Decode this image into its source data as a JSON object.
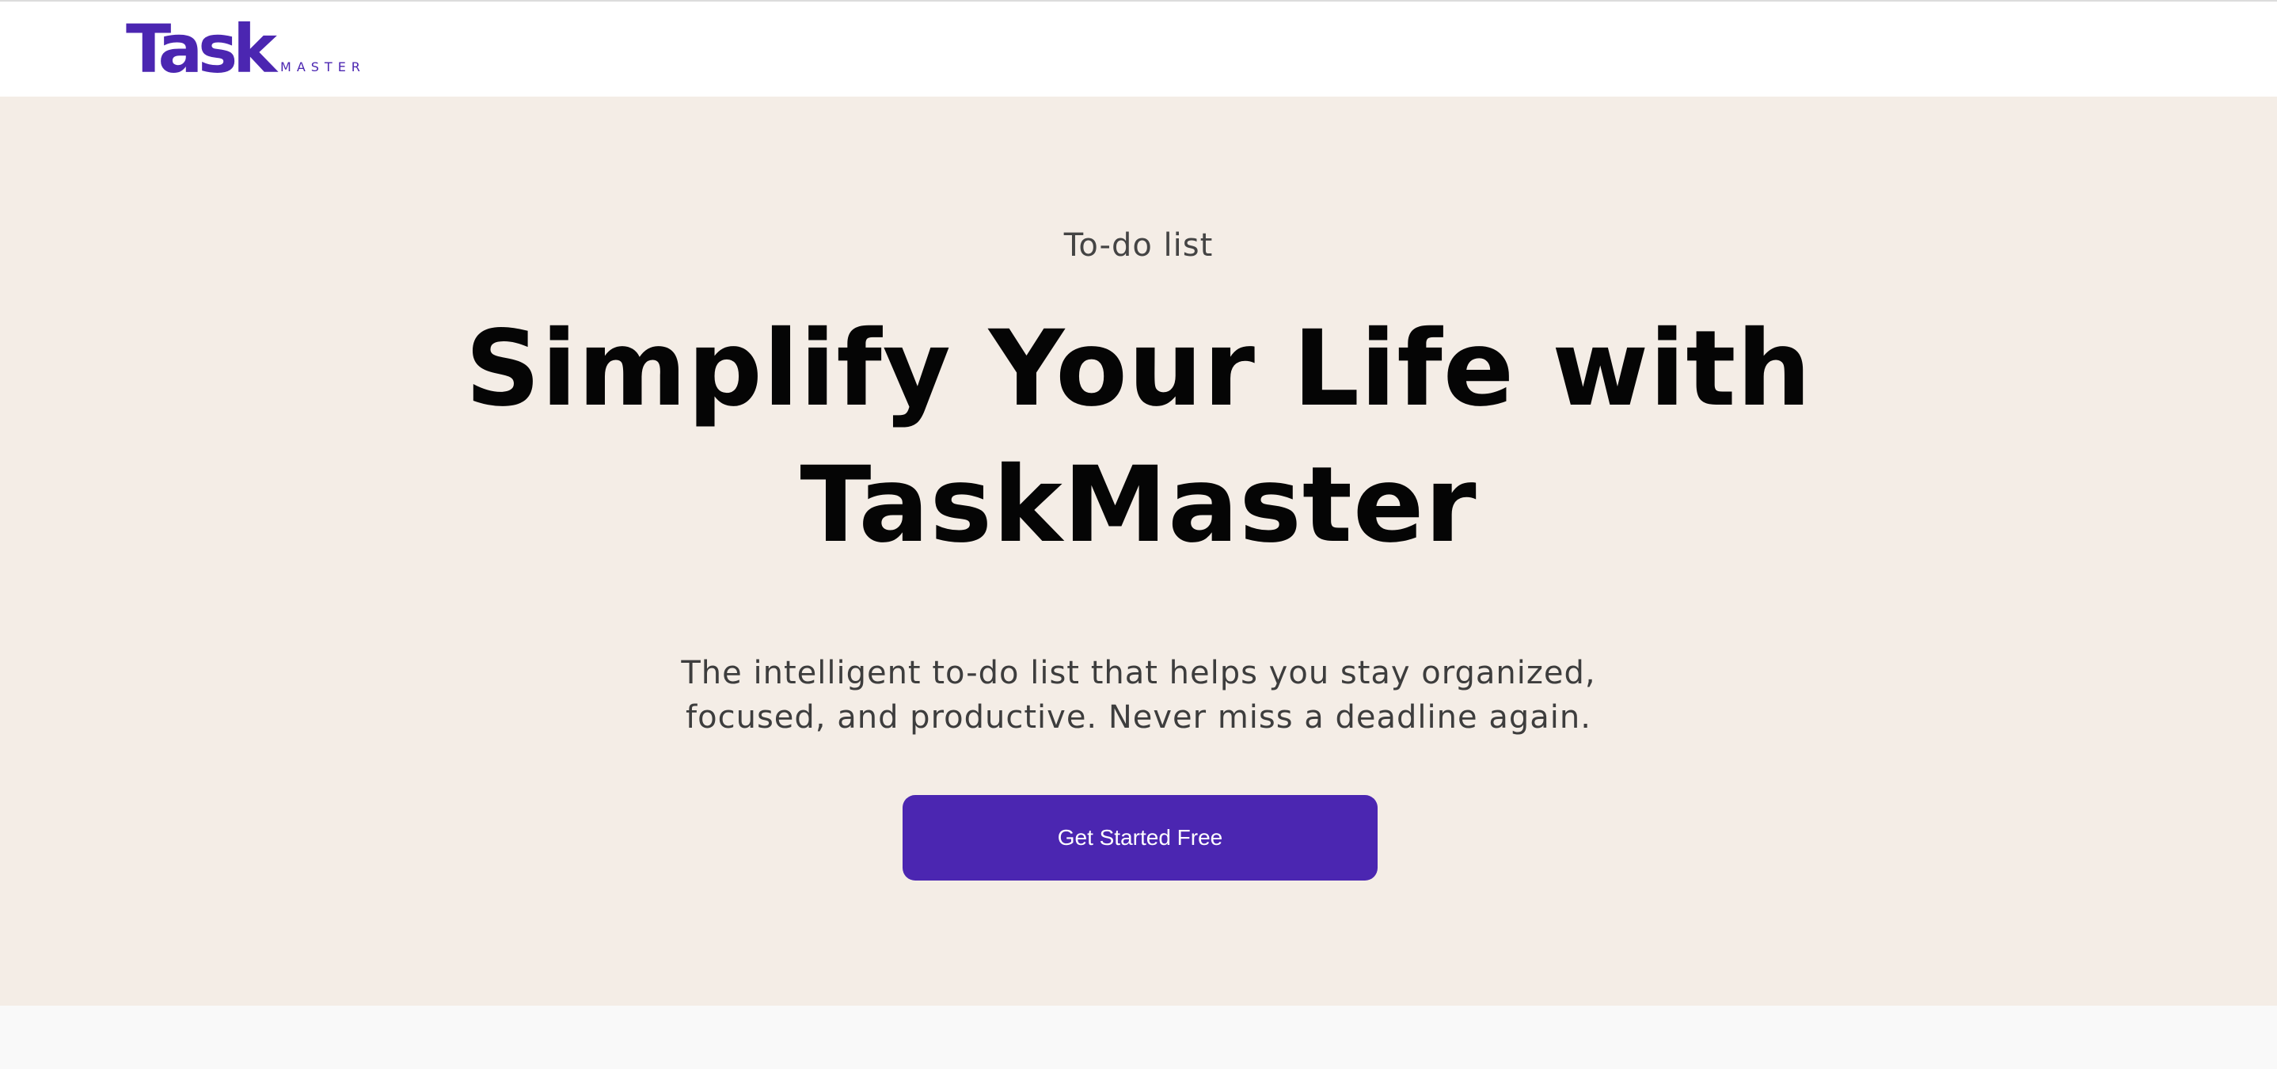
{
  "navbar": {
    "logo": {
      "word": "Task",
      "sub": "MASTER"
    }
  },
  "hero": {
    "eyebrow": "To-do list",
    "headline": "Simplify Your Life with TaskMaster",
    "subtext": "The intelligent to-do list that helps you stay organized, focused, and productive. Never miss a deadline again.",
    "cta_label": "Get Started Free"
  },
  "colors": {
    "brand": "#4b26b1",
    "hero_background": "#f4ede6",
    "header_background": "#ffffff",
    "page_background": "#f9f9f9"
  }
}
